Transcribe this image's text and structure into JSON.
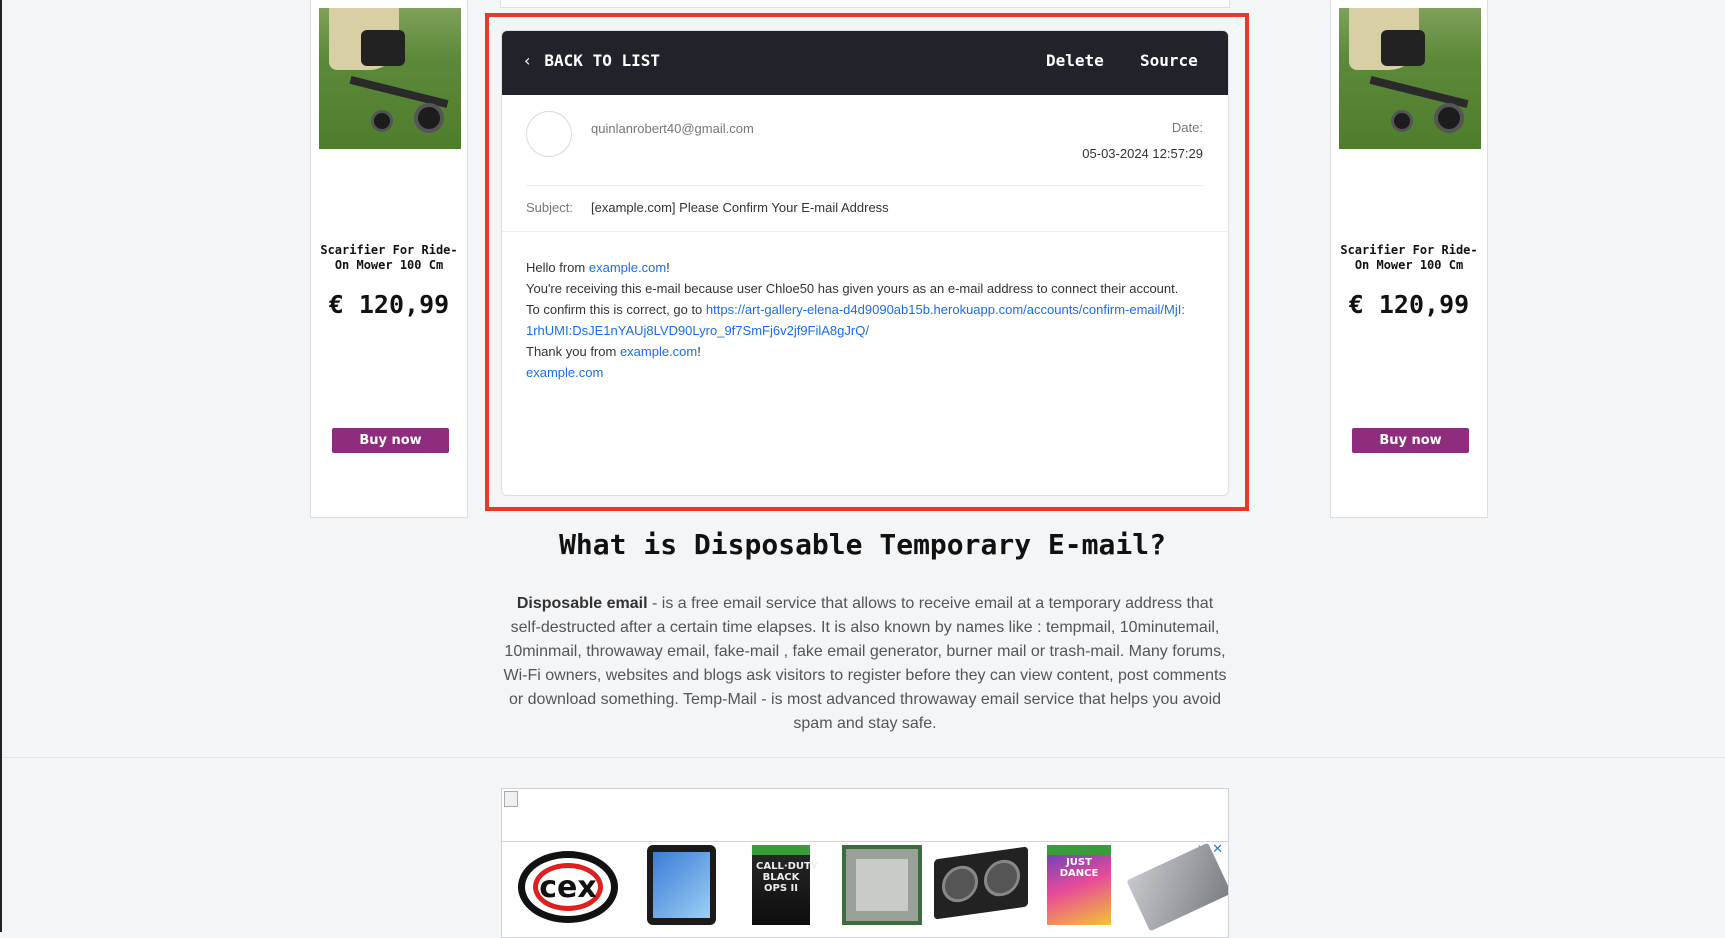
{
  "side_ads": [
    {
      "title": "Scarifier For Ride-On Mower 100 Cm",
      "price": "€ 120,99",
      "button": "Buy now"
    },
    {
      "title": "Scarifier For Ride-On Mower 100 Cm",
      "price": "€ 120,99",
      "button": "Buy now"
    }
  ],
  "email": {
    "toolbar": {
      "back_label": "BACK TO LIST",
      "back_icon": "‹",
      "delete_label": "Delete",
      "source_label": "Source"
    },
    "from": "quinlanrobert40@gmail.com",
    "date_label": "Date:",
    "date_value": "05-03-2024 12:57:29",
    "subject_label": "Subject:",
    "subject_value": "[example.com] Please Confirm Your E-mail Address",
    "body": {
      "greeting_prefix": "Hello from ",
      "greeting_link": "example.com",
      "greeting_suffix": "!",
      "line2": "You're receiving this e-mail because user Chloe50 has given yours as an e-mail address to connect their account.",
      "confirm_prefix": "To confirm this is correct, go to ",
      "confirm_link": "https://art-gallery-elena-d4d9090ab15b.herokuapp.com/accounts/confirm-email/MjI:1rhUMI:DsJE1nYAUj8LVD90Lyro_9f7SmFj6v2jf9FilA8gJrQ/",
      "thanks_prefix": "Thank you from ",
      "thanks_link": "example.com",
      "thanks_suffix": "!",
      "signature_link": "example.com"
    }
  },
  "info": {
    "title": "What is Disposable Temporary E-mail?",
    "text_bold": "Disposable email",
    "text": " - is a free email service that allows to receive email at a temporary address that self-destructed after a certain time elapses. It is also known by names like : tempmail, 10minutemail, 10minmail, throwaway email, fake-mail , fake email generator, burner mail or trash-mail. Many forums, Wi-Fi owners, websites and blogs ask visitors to register before they can view content, post comments or download something. Temp-Mail - is most advanced throwaway email service that helps you avoid spam and stay safe."
  },
  "bottom_ad": {
    "logo_text": "cex",
    "adchoices_icon": "▷",
    "close_icon": "✕",
    "game1_title": "CALL·DUTY BLACK OPS II",
    "game2_title": "JUST DANCE"
  },
  "colors": {
    "accent_red": "#e53b26",
    "buy_button": "#8e2c7e",
    "header_bg": "#20232a",
    "link": "#1a6fe0"
  }
}
